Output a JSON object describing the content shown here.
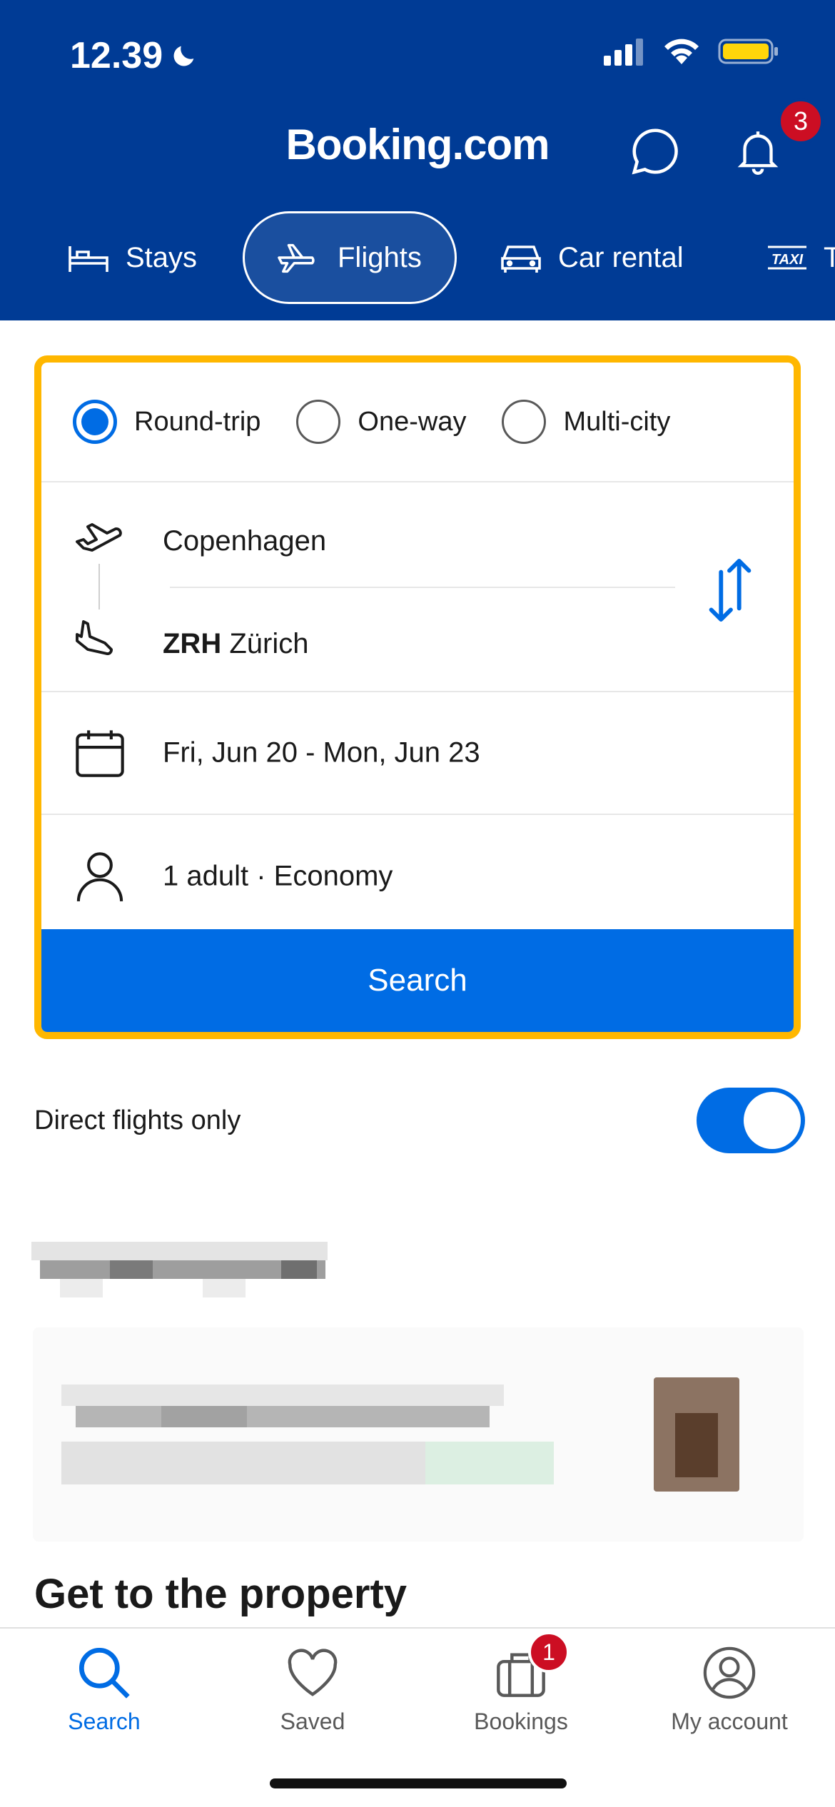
{
  "status_bar": {
    "time": "12.39",
    "moon_icon": "moon-icon",
    "signal_icon": "cellular-signal-icon",
    "wifi_icon": "wifi-icon",
    "battery_icon": "battery-icon",
    "battery_color": "#ffd60a"
  },
  "header": {
    "logo": "Booking.com",
    "chat_icon": "chat-bubble-icon",
    "notification_icon": "bell-icon",
    "notification_count": "3",
    "background_color": "#003b95"
  },
  "nav_tabs": [
    {
      "label": "Stays",
      "icon": "bed-icon",
      "active": false
    },
    {
      "label": "Flights",
      "icon": "plane-icon",
      "active": true
    },
    {
      "label": "Car rental",
      "icon": "car-icon",
      "active": false
    },
    {
      "label": "T",
      "icon": "taxi-icon",
      "active": false
    }
  ],
  "search_form": {
    "border_color": "#ffb700",
    "trip_types": [
      {
        "label": "Round-trip",
        "selected": true
      },
      {
        "label": "One-way",
        "selected": false
      },
      {
        "label": "Multi-city",
        "selected": false
      }
    ],
    "origin": {
      "code": "",
      "city": "Copenhagen",
      "icon": "plane-departure-icon"
    },
    "destination": {
      "code": "ZRH",
      "city": "Zürich",
      "icon": "plane-arrival-icon"
    },
    "swap_icon": "swap-arrows-icon",
    "dates": {
      "value": "Fri, Jun 20 - Mon, Jun 23",
      "icon": "calendar-icon"
    },
    "travelers": {
      "value": "1 adult · Economy",
      "icon": "person-icon"
    },
    "search_button": "Search",
    "accent_color": "#006ce4"
  },
  "direct_flights": {
    "label": "Direct flights only",
    "enabled": true
  },
  "section_heading": "Get to the property",
  "tab_bar": [
    {
      "label": "Search",
      "icon": "search-icon",
      "active": true,
      "badge": ""
    },
    {
      "label": "Saved",
      "icon": "heart-icon",
      "active": false,
      "badge": ""
    },
    {
      "label": "Bookings",
      "icon": "suitcase-icon",
      "active": false,
      "badge": "1"
    },
    {
      "label": "My account",
      "icon": "user-circle-icon",
      "active": false,
      "badge": ""
    }
  ]
}
